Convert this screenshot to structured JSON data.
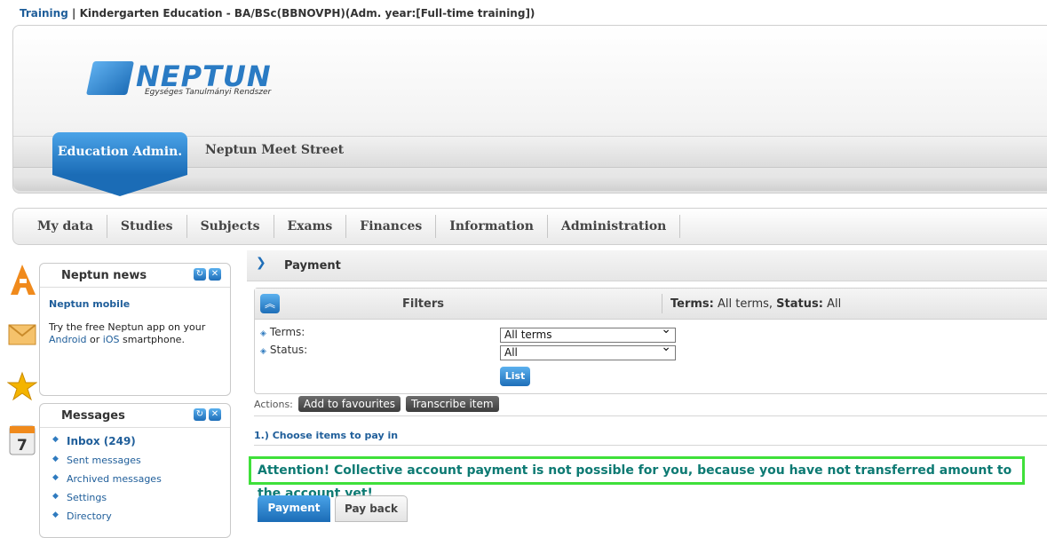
{
  "breadcrumb": {
    "link": "Training",
    "separator": "|",
    "program": "Kindergarten Education - BA/BSc(BBNOVPH)(Adm. year:[Full-time training])"
  },
  "logo": {
    "word": "NEPTUN",
    "subtitle": "Egységes Tanulmányi Rendszer"
  },
  "header": {
    "active_tab": "Education Admin.",
    "other_tab": "Neptun Meet Street"
  },
  "nav": {
    "items": [
      "My data",
      "Studies",
      "Subjects",
      "Exams",
      "Finances",
      "Information",
      "Administration"
    ]
  },
  "side_icons": [
    "calendar-a-icon",
    "envelope-icon",
    "star-icon",
    "calendar-7-icon"
  ],
  "news_panel": {
    "title": "Neptun news",
    "item_title": "Neptun mobile",
    "text_prefix": "Try the free Neptun app on your",
    "android": "Android",
    "or": "or",
    "ios": "iOS",
    "text_suffix": "smartphone."
  },
  "messages_panel": {
    "title": "Messages",
    "items": [
      "Inbox (249)",
      "Sent messages",
      "Archived messages",
      "Settings",
      "Directory"
    ]
  },
  "main": {
    "title": "Payment",
    "filters": {
      "label": "Filters",
      "summary_terms_label": "Terms:",
      "summary_terms_value": "All terms,",
      "summary_status_label": "Status:",
      "summary_status_value": "All",
      "terms_label": "Terms:",
      "terms_value": "All terms",
      "status_label": "Status:",
      "status_value": "All",
      "list_button": "List"
    },
    "actions": {
      "label": "Actions:",
      "buttons": [
        "Add to favourites",
        "Transcribe item"
      ]
    },
    "step": "1.) Choose items to pay in",
    "attention": "Attention! Collective account payment is not possible for you, because you have not transferred amount to the account yet!",
    "tabs": [
      "Payment",
      "Pay back"
    ]
  },
  "colors": {
    "accent": "#1e6eb8",
    "attention_border": "#3fe03a",
    "attention_text": "#0d7a73"
  }
}
